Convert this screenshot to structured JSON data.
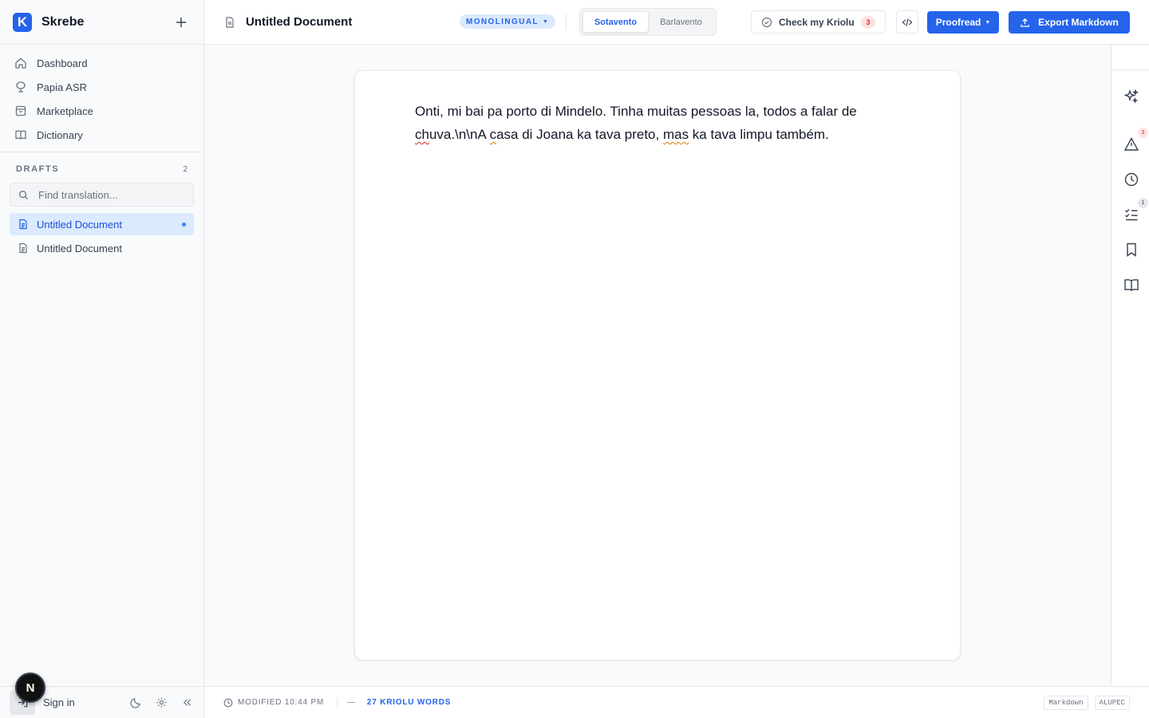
{
  "app": {
    "name": "Skrebe",
    "logo_letter": "K",
    "dev_badge": "N"
  },
  "sidebar": {
    "nav": [
      {
        "label": "Dashboard",
        "icon": "home-icon"
      },
      {
        "label": "Papia ASR",
        "icon": "microphone-icon"
      },
      {
        "label": "Marketplace",
        "icon": "store-icon"
      },
      {
        "label": "Dictionary",
        "icon": "book-icon"
      }
    ],
    "drafts_title": "DRAFTS",
    "drafts_count": "2",
    "search_placeholder": "Find translation...",
    "drafts": [
      {
        "label": "Untitled Document",
        "active": true
      },
      {
        "label": "Untitled Document",
        "active": false
      }
    ],
    "footer": {
      "signin_label": "Sign in"
    }
  },
  "header": {
    "doc_title": "Untitled Document",
    "mode": "MONOLINGUAL",
    "variants": [
      "Sotavento",
      "Barlavento"
    ],
    "active_variant": "Sotavento",
    "check_label": "Check my Kriolu",
    "check_count": "3",
    "proofread_label": "Proofread",
    "export_label": "Export Markdown"
  },
  "editor": {
    "segments": [
      {
        "text": "Onti, mi bai pa porto di Mindelo. Tinha muitas pessoas la, todos a falar de ",
        "mark": ""
      },
      {
        "text": "ch",
        "mark": "err"
      },
      {
        "text": "uva.\\n\\nA ",
        "mark": ""
      },
      {
        "text": "c",
        "mark": "warn"
      },
      {
        "text": "asa di Joana ka tava preto, ",
        "mark": ""
      },
      {
        "text": "mas",
        "mark": "warn"
      },
      {
        "text": " ka tava limpu também.",
        "mark": ""
      }
    ]
  },
  "rail": {
    "warnings_badge": "3",
    "tasks_badge": "1"
  },
  "status": {
    "modified": "MODIFIED 10:44 PM",
    "dash": "—",
    "words": "27 KRIOLU WORDS",
    "tags": [
      "Markdown",
      "ALUPEC"
    ]
  },
  "colors": {
    "accent": "#2563eb",
    "error": "#dc2626",
    "warning": "#d97706"
  }
}
